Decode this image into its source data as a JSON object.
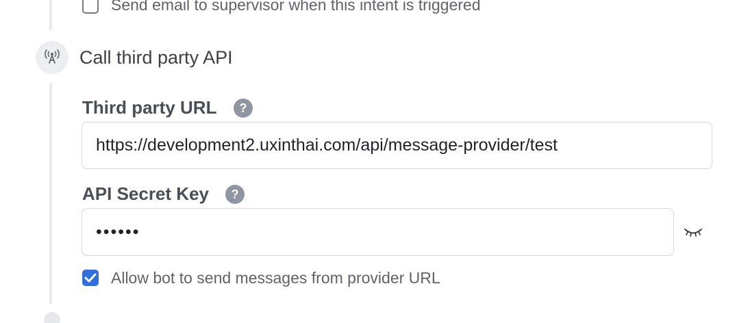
{
  "notifications": {
    "email_supervisor_label": "Send email to supervisor when this intent is triggered",
    "email_supervisor_checked": false
  },
  "step": {
    "title": "Call third party API",
    "icon": "broadcast-tower-icon"
  },
  "third_party_url": {
    "label": "Third party URL",
    "help_icon": "?",
    "value": "https://development2.uxinthai.com/api/message-provider/test"
  },
  "api_secret_key": {
    "label": "API Secret Key",
    "help_icon": "?",
    "masked_value": "••••••",
    "visibility_icon": "eye-closed-icon"
  },
  "allow_provider": {
    "label": "Allow bot to send messages from provider URL",
    "checked": true
  },
  "colors": {
    "accent": "#2f6fe0",
    "timeline": "#e7e9ec",
    "help_icon": "#8f96a1"
  }
}
